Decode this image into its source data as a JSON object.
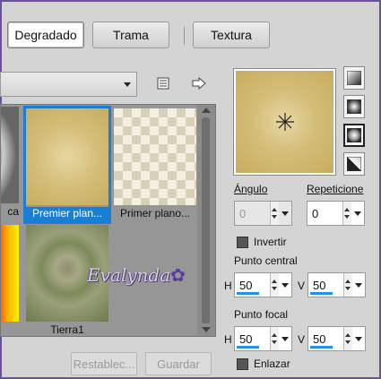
{
  "tabs": [
    {
      "label": "Degradado",
      "active": true
    },
    {
      "label": "Trama",
      "active": false
    },
    {
      "label": "Textura",
      "active": false
    }
  ],
  "gallery": {
    "items": [
      {
        "label": "ca"
      },
      {
        "label": "Premier plan...",
        "selected": true
      },
      {
        "label": "Primer plano..."
      },
      {
        "label": ""
      },
      {
        "label": "Tierra1"
      }
    ],
    "watermark": "Evalynda"
  },
  "buttons": {
    "reset": "Restablec...",
    "save": "Guardar"
  },
  "properties": {
    "angle_label": "Ángulo",
    "angle_value": "0",
    "repeats_label": "Repeticione",
    "repeats_value": "0",
    "invert_label": "Invertir",
    "center_label": "Punto central",
    "center_h_label": "H",
    "center_h_value": "50",
    "center_v_label": "V",
    "center_v_value": "50",
    "focal_label": "Punto focal",
    "focal_h_label": "H",
    "focal_h_value": "50",
    "focal_v_label": "V",
    "focal_v_value": "50",
    "link_label": "Enlazar"
  },
  "colors": {
    "accent": "#1a7fd4",
    "gradient_center": "#e6d7a4",
    "gradient_edge": "#c8ad5e"
  }
}
